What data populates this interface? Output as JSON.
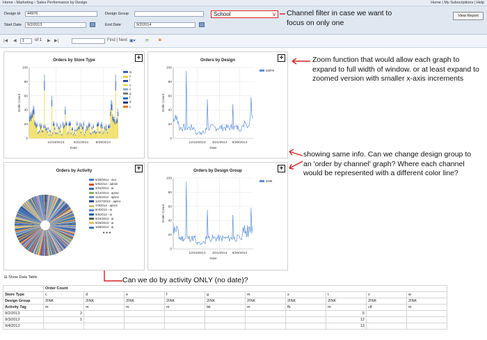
{
  "breadcrumb": {
    "left": "Home › Marketing › Sales Performance by Design",
    "right": "Home | My Subscriptions | Help"
  },
  "params": {
    "design_id_label": "Design Id",
    "design_id_value": "44976",
    "design_group_label": "Design Group",
    "design_group_value": "",
    "start_label": "Start Date",
    "start_value": "9/2/2013",
    "end_label": "End Date",
    "end_value": "9/2/2014",
    "channel_value": "School",
    "view_report": "View Report"
  },
  "toolbar": {
    "page_value": "1",
    "of": "of 1",
    "find": "Find | Next"
  },
  "annotations": {
    "channel": "Channel filter in case we want to focus on only one",
    "zoom": "Zoom function that would allow each graph to expand to full width of window. or at least expand to zoomed version with smaller x-axis increments",
    "group": "showing same info. Can we change design group to an 'order by channel' graph? Where each channel would be represented with a different color line?",
    "activity": "Can we do by activity ONLY (no date)?"
  },
  "charts": {
    "store": {
      "title": "Orders by Store Type",
      "ylabel": "Order Count",
      "xlabel": "Date",
      "yticks": [
        "100",
        "80",
        "60",
        "40",
        "20",
        "0"
      ],
      "xticks": [
        "12/10/2013",
        "3/21/2014",
        "6/29/2014"
      ],
      "legend": [
        {
          "label": "w",
          "color": "#3a62b8"
        },
        {
          "label": "v",
          "color": "#e8d04a"
        },
        {
          "label": "t",
          "color": "#2b4f9a"
        },
        {
          "label": "s",
          "color": "#f0e06a"
        },
        {
          "label": "n",
          "color": "#8ab0d8"
        },
        {
          "label": "g",
          "color": "#7a7a7a"
        },
        {
          "label": "f",
          "color": "#2f6cc0"
        },
        {
          "label": "d",
          "color": "#1a3d7a"
        },
        {
          "label": "c",
          "color": "#e07a2a"
        }
      ]
    },
    "design": {
      "title": "Orders by Design",
      "ylabel": "Order Count",
      "xlabel": "Date",
      "yticks": [
        "100",
        "80",
        "60",
        "40",
        "20",
        "0"
      ],
      "xticks": [
        "12/10/2013",
        "3/21/2014",
        "6/29/2014"
      ],
      "legend": "44976"
    },
    "activity": {
      "title": "Orders by Activity",
      "legend": [
        {
          "label": "5/29/2014 - 4x4",
          "color": "#4a7cc8"
        },
        {
          "label": "5/6/2014 - admin",
          "color": "#d05030"
        },
        {
          "label": "3/31/2014 - ai",
          "color": "#3a6ab0"
        },
        {
          "label": "9/12/2013 - apsnc",
          "color": "#90b070"
        },
        {
          "label": "11/6/2013 - apsnc",
          "color": "#6a8ac8"
        },
        {
          "label": "12/27/2013 - apsnc",
          "color": "#2a4a8a"
        },
        {
          "label": "7/3/2014 - apsnc",
          "color": "#c8c070"
        },
        {
          "label": "9/4/2013 - ai",
          "color": "#5a8ad0"
        },
        {
          "label": "9/5/2013 - ai",
          "color": "#2a5aa8"
        },
        {
          "label": "9/24/2013 - ai",
          "color": "#5a5a5a"
        },
        {
          "label": "9/26/2013 - ai",
          "color": "#e8c060"
        },
        {
          "label": "10/8/2013 - ai",
          "color": "#3a7ac0"
        }
      ],
      "more": "• • •"
    },
    "group": {
      "title": "Orders by Design Group",
      "ylabel": "Order Count",
      "xlabel": "Date",
      "yticks": [
        "100",
        "80",
        "60",
        "40",
        "20",
        "0"
      ],
      "xticks": [
        "12/10/2013",
        "3/21/2014",
        "6/29/2014"
      ],
      "legend": "2INK"
    }
  },
  "datatable": {
    "toggle": "⊟ Show Data Table",
    "order_count": "Order Count",
    "rows": [
      {
        "label": "Store Type",
        "cells": [
          "c",
          "d",
          "e",
          "f",
          "g",
          "m",
          "s",
          "t",
          "v",
          "w"
        ]
      },
      {
        "label": "Design Group",
        "cells": [
          "2INK",
          "2INK",
          "2INK",
          "2INK",
          "2INK",
          "2INK",
          "2INK",
          "2INK",
          "2INK",
          "2INK"
        ]
      },
      {
        "label": "Activity Tag",
        "cells": [
          "m",
          "m",
          "m",
          "m",
          "bk",
          "m",
          "fb",
          "m",
          "clf",
          "m"
        ]
      },
      {
        "label": "9/2/2013",
        "cells": [
          "2",
          "",
          "",
          "",
          "",
          "",
          "",
          "5",
          "",
          ""
        ]
      },
      {
        "label": "9/3/2013",
        "cells": [
          "1",
          "",
          "",
          "",
          "",
          "",
          "",
          "12",
          "",
          ""
        ]
      },
      {
        "label": "9/4/2013",
        "cells": [
          "",
          "",
          "",
          "",
          "",
          "",
          "",
          "13",
          "",
          ""
        ]
      }
    ]
  },
  "colors": {
    "line": "#5b8fd6",
    "annotation_arrow": "#d02020"
  }
}
